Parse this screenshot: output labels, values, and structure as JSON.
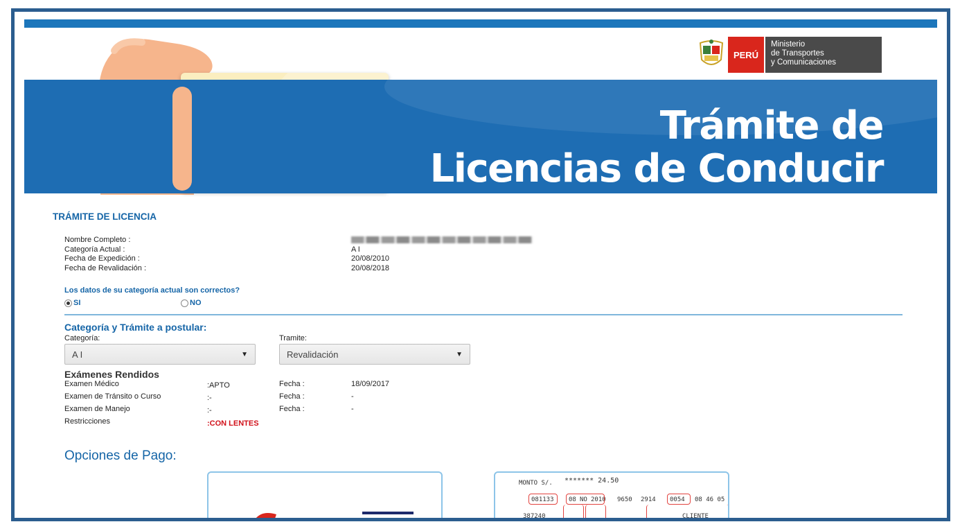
{
  "header": {
    "title_line1": "Trámite de",
    "title_line2": "Licencias de Conducir",
    "peru_label": "PERÚ",
    "ministry_line1": "Ministerio",
    "ministry_line2": "de Transportes",
    "ministry_line3": "y Comunicaciones"
  },
  "section_title": "TRÁMITE DE LICENCIA",
  "info": {
    "labels": [
      "Nombre Completo :",
      "Categoría Actual :",
      "Fecha de Expedición :",
      "Fecha de Revalidación :"
    ],
    "categoria_actual": "A I",
    "fecha_expedicion": "20/08/2010",
    "fecha_revalidacion": "20/08/2018"
  },
  "question": {
    "text": "Los datos de su categoría actual son correctos?",
    "yes_label": "SI",
    "no_label": "NO",
    "selected": "SI"
  },
  "postular": {
    "title": "Categoría y Trámite a postular:",
    "categoria_label": "Categoría:",
    "categoria_value": "A I",
    "tramite_label": "Tramite:",
    "tramite_value": "Revalidación"
  },
  "exams": {
    "title": "Exámenes Rendidos",
    "rows": [
      {
        "label": "Examen Médico",
        "value": ":APTO",
        "fecha_label": "Fecha :",
        "fecha": "18/09/2017"
      },
      {
        "label": "Examen de Tránsito o Curso",
        "value": ":-",
        "fecha_label": "Fecha :",
        "fecha": "-"
      },
      {
        "label": "Examen de Manejo",
        "value": ":-",
        "fecha_label": "Fecha :",
        "fecha": "-"
      }
    ],
    "restricciones_label": "Restricciones",
    "restricciones_value": ":CON LENTES"
  },
  "payment": {
    "title": "Opciones de Pago:",
    "receipt": {
      "monto_label": "MONTO S/.",
      "monto_value": "******* 24.50",
      "codes": [
        "081133",
        "08",
        "NO",
        "2010",
        "9650",
        "2914",
        "0054",
        "08 46 05"
      ],
      "line2": "387240",
      "cliente": "CLIENTE"
    }
  },
  "colors": {
    "brand_blue": "#1e6db3",
    "accent_red": "#d1121b",
    "peru_red": "#d9261c"
  }
}
